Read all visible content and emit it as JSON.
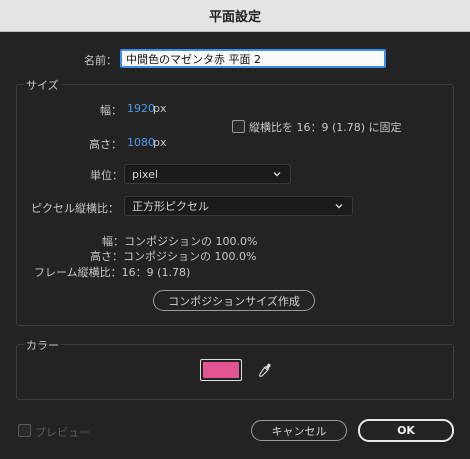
{
  "dialog": {
    "title": "平面設定"
  },
  "name_field": {
    "label": "名前：",
    "value": "中間色のマゼンタ赤 平面 2"
  },
  "size_group": {
    "title": "サイズ",
    "width": {
      "label": "幅：",
      "value": "1920",
      "unit": "px"
    },
    "height": {
      "label": "高さ：",
      "value": "1080",
      "unit": "px"
    },
    "lock_aspect": {
      "label": "縦横比を 16：9 (1.78) に固定",
      "checked": false
    },
    "units": {
      "label": "単位：",
      "value": "pixel"
    },
    "pixel_aspect": {
      "label": "ピクセル縦横比：",
      "value": "正方形ピクセル"
    },
    "info": {
      "width_line": "幅：コンポジションの 100.0%",
      "height_line": "高さ：コンポジションの 100.0%",
      "frame_line": "フレーム縦横比：16：9 (1.78)"
    },
    "make_comp_size_button": "コンポジションサイズ作成"
  },
  "color_group": {
    "title": "カラー",
    "swatch_color": "#e05592",
    "eyedropper_icon": "eyedropper-icon"
  },
  "footer": {
    "preview": {
      "label": "プレビュー",
      "checked": false,
      "enabled": false
    },
    "cancel_button": "キャンセル",
    "ok_button": "OK"
  },
  "colors": {
    "accent_blue": "#4b9cf5",
    "focus_border": "#3b8ff0"
  }
}
